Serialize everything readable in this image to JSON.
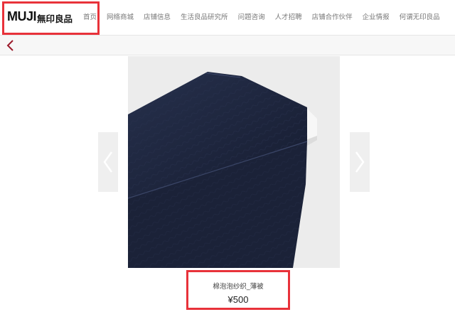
{
  "header": {
    "logo_latin": "MUJI",
    "logo_cjk": "無印良品",
    "nav": [
      "首页",
      "网络商城",
      "店铺信息",
      "生活良品研究所",
      "问题咨询",
      "人才招聘",
      "店铺合作伙伴",
      "企业情报",
      "何谓无印良品"
    ]
  },
  "product": {
    "name": "棉泡泡纱织_薄被",
    "price": "¥500"
  },
  "carousel": {
    "slide_count": 2,
    "active_index": 0,
    "dot_active_color": "#9a9a9a",
    "dot_inactive_color": "#ffffff"
  },
  "colors": {
    "highlight": "#e8323a",
    "back_arrow": "#9b1b2b"
  }
}
